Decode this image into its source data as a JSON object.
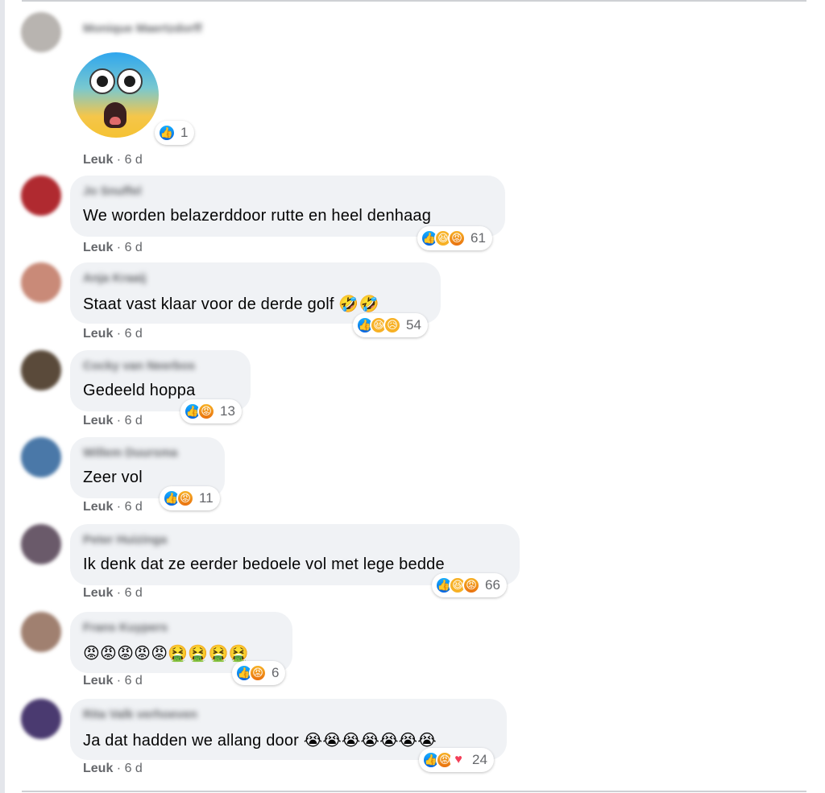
{
  "like_label": "Leuk",
  "comments": [
    {
      "author": "Monique Maertzdorff",
      "text": "",
      "reaction_icons": [
        "like"
      ],
      "reaction_count": "1",
      "time": "6 d",
      "avatar_color": "#b8b4b0"
    },
    {
      "author": "Jo Snuffel",
      "text": "We worden belazerddoor rutte en heel denhaag",
      "reaction_icons": [
        "like",
        "haha",
        "angry"
      ],
      "reaction_count": "61",
      "time": "6 d",
      "avatar_color": "#b02a30"
    },
    {
      "author": "Anja Kraaij",
      "text": "Staat vast klaar voor de derde golf",
      "text_emojis": "🤣🤣",
      "reaction_icons": [
        "like",
        "haha",
        "sad"
      ],
      "reaction_count": "54",
      "time": "6 d",
      "avatar_color": "#c98a78"
    },
    {
      "author": "Cocky van Neerbos",
      "text": "Gedeeld hoppa",
      "reaction_icons": [
        "like",
        "angry"
      ],
      "reaction_count": "13",
      "time": "6 d",
      "avatar_color": "#5a4a3a"
    },
    {
      "author": "Willem Duursma",
      "text": "Zeer vol",
      "reaction_icons": [
        "like",
        "angry"
      ],
      "reaction_count": "11",
      "time": "6 d",
      "avatar_color": "#4a78a8"
    },
    {
      "author": "Peter Huizinga",
      "text": "Ik denk dat ze eerder bedoele vol met lege bedde",
      "reaction_icons": [
        "like",
        "haha",
        "angry"
      ],
      "reaction_count": "66",
      "time": "6 d",
      "avatar_color": "#6a5a6a"
    },
    {
      "author": "Frans Kuypers",
      "text": "",
      "text_emojis": "😡😡😡😡😡🤮🤮🤮🤮",
      "reaction_icons": [
        "like",
        "angry"
      ],
      "reaction_count": "6",
      "time": "6 d",
      "avatar_color": "#a08070"
    },
    {
      "author": "Rita Valk verhoeven",
      "text": "Ja dat hadden we allang door",
      "text_emojis": "😭😭😭😭😭😭😭",
      "reaction_icons": [
        "like",
        "angry",
        "love"
      ],
      "reaction_count": "24",
      "time": "6 d",
      "avatar_color": "#4a3a70"
    }
  ],
  "reaction_glyphs": {
    "like": "👍",
    "haha": "😆",
    "angry": "😡",
    "sad": "😥",
    "love": "♥"
  },
  "colors": {
    "bubble": "#f0f2f5",
    "meta_text": "#65676b",
    "like_blue": "#1877f2"
  }
}
